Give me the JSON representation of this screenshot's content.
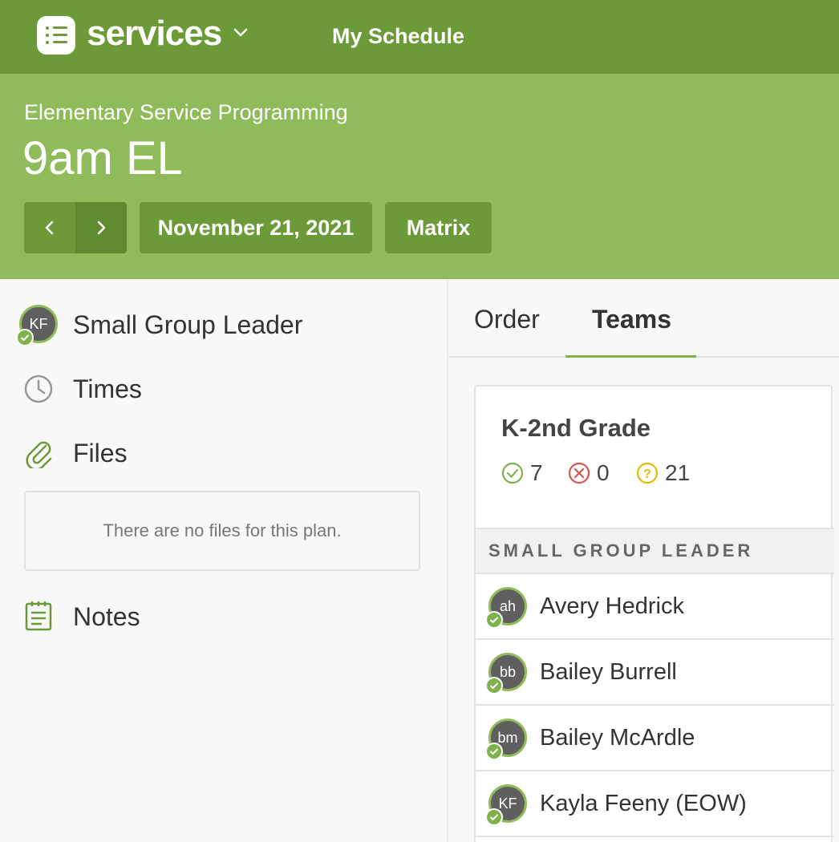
{
  "topbar": {
    "app_name": "services",
    "nav_link": "My Schedule",
    "colors": {
      "topbar_bg": "#6c9a38",
      "header_bg": "#8fbb5a"
    }
  },
  "header": {
    "subtitle": "Elementary Service Programming",
    "title": "9am EL",
    "prev_icon": "chevron-left-icon",
    "next_icon": "chevron-right-icon",
    "date_label": "November 21, 2021",
    "matrix_label": "Matrix"
  },
  "sidebar": {
    "role": {
      "initials": "KF",
      "label": "Small Group Leader",
      "status": "confirmed"
    },
    "times_label": "Times",
    "files_label": "Files",
    "files_empty": "There are no files for this plan.",
    "notes_label": "Notes"
  },
  "tabs": [
    {
      "label": "Order",
      "active": false
    },
    {
      "label": "Teams",
      "active": true
    }
  ],
  "team": {
    "name": "K-2nd Grade",
    "stats": {
      "confirmed": "7",
      "declined": "0",
      "unconfirmed": "21"
    },
    "role_header": "SMALL GROUP LEADER",
    "members": [
      {
        "initials": "ah",
        "name": "Avery Hedrick",
        "status": "confirmed"
      },
      {
        "initials": "bb",
        "name": "Bailey Burrell",
        "status": "confirmed"
      },
      {
        "initials": "bm",
        "name": "Bailey McArdle",
        "status": "confirmed"
      },
      {
        "initials": "KF",
        "name": "Kayla Feeny (EOW)",
        "status": "confirmed"
      }
    ]
  }
}
